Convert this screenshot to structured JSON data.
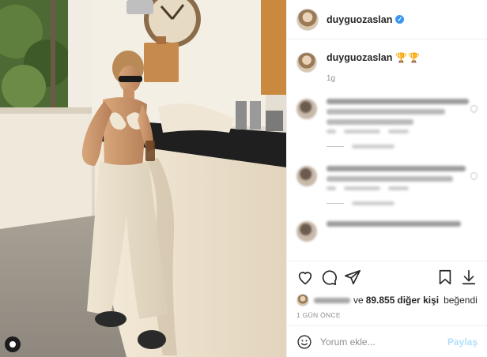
{
  "post": {
    "username": "duyguozaslan",
    "verified_icon": "verified-badge-icon",
    "caption": {
      "username": "duyguozaslan",
      "emojis": "🏆🏆",
      "time": "1g"
    },
    "photo": {
      "badge_icon": "user-tag-icon"
    }
  },
  "actions": {
    "like_icon": "heart-icon",
    "comment_icon": "comment-icon",
    "share_icon": "paper-plane-icon",
    "save_icon": "bookmark-icon",
    "download_icon": "download-icon"
  },
  "likes": {
    "text_connector": "ve",
    "count": "89.855",
    "suffix": "diğer kişi",
    "verb": "beğendi"
  },
  "time_ago": "1 GÜN ÖNCE",
  "comment_box": {
    "placeholder": "Yorum ekle...",
    "post_label": "Paylaş",
    "emoji_icon": "smiley-icon"
  },
  "colors": {
    "verified": "#3897f0",
    "post_button_disabled": "#b2dffc",
    "muted": "#8e8e8e"
  }
}
